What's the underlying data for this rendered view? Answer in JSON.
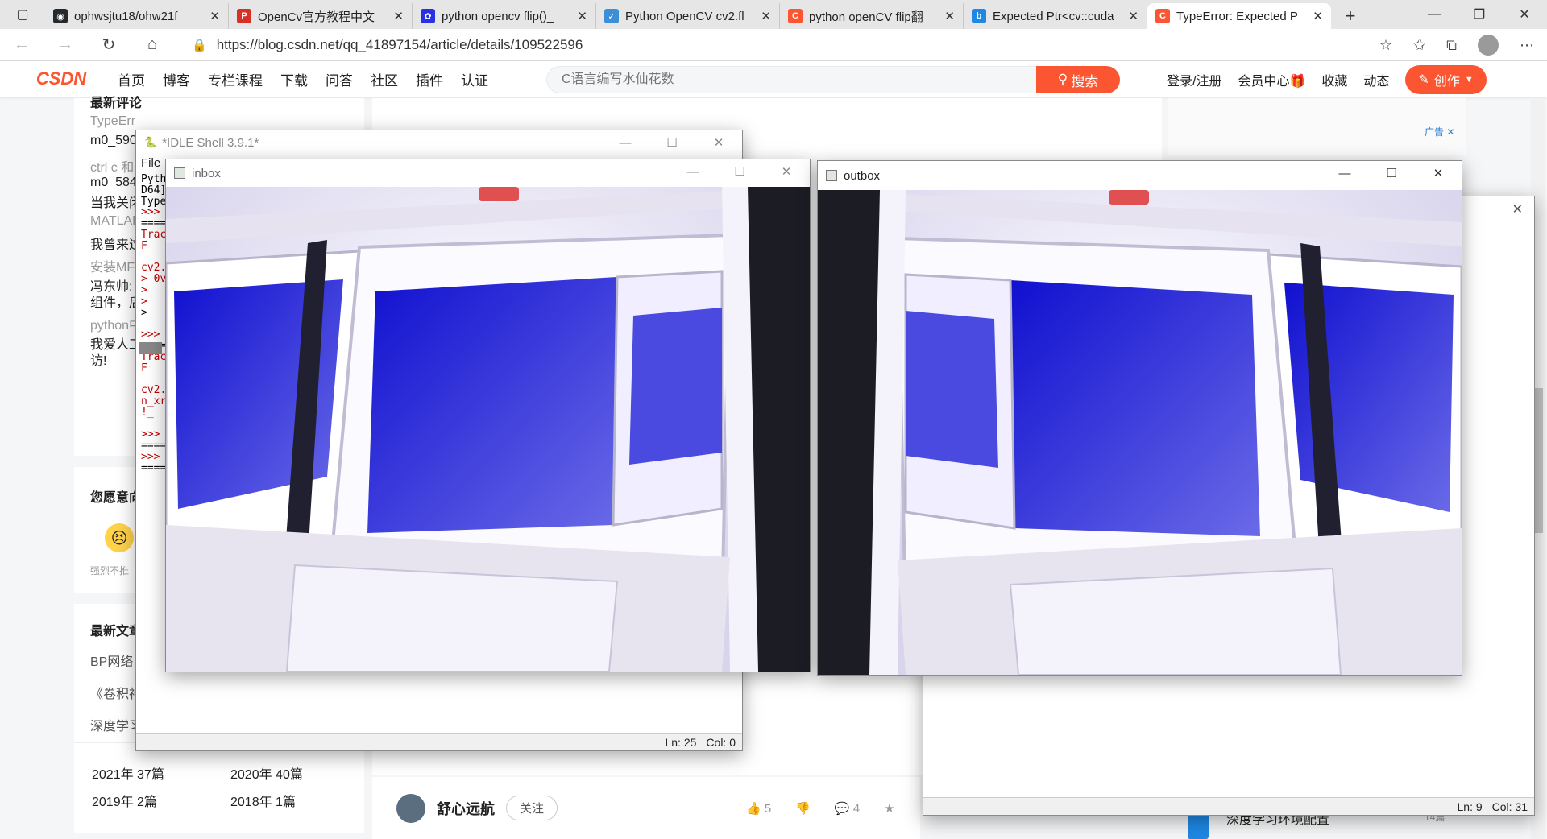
{
  "browser": {
    "tabs": [
      {
        "title": "ophwsjtu18/ohw21f",
        "favicon": "github-icon",
        "color": "#24292e",
        "glyph": "◉"
      },
      {
        "title": "OpenCv官方教程中文",
        "favicon": "pdf-icon",
        "color": "#d93025",
        "glyph": "P"
      },
      {
        "title": "python opencv flip()_",
        "favicon": "baidu-paw-icon",
        "color": "#2932e1",
        "glyph": "✿"
      },
      {
        "title": "Python OpenCV cv2.fl",
        "favicon": "check-icon",
        "color": "#3a8fd6",
        "glyph": "✓"
      },
      {
        "title": "python openCV flip翻",
        "favicon": "csdn-c-icon",
        "color": "#fc5531",
        "glyph": "C"
      },
      {
        "title": "Expected Ptr<cv::cuda",
        "favicon": "bing-icon",
        "color": "#1e88e5",
        "glyph": "b"
      },
      {
        "title": "TypeError: Expected P",
        "favicon": "csdn-c-icon",
        "color": "#fc5531",
        "glyph": "C"
      }
    ],
    "url": "https://blog.csdn.net/qq_41897154/article/details/109522596"
  },
  "csdn": {
    "nav": [
      "首页",
      "博客",
      "专栏课程",
      "下载",
      "问答",
      "社区",
      "插件",
      "认证"
    ],
    "search_placeholder": "C语言编写水仙花数",
    "search_button": "搜索",
    "header_right": {
      "login": "登录/注册",
      "vip": "会员中心",
      "collect": "收藏",
      "dynamic": "动态",
      "create": "创作"
    },
    "ad_label": "广告",
    "sidebar": {
      "recent_comments_title": "最新评论",
      "comment_lines": [
        "TypeErr",
        "m0_590",
        "ctrl c 和",
        "m0_584",
        "当我关闭",
        "MATLAB",
        "我曾来过",
        "安装MF",
        "冯东帅:",
        "组件，后",
        "python中",
        "我爱人工",
        "访!"
      ],
      "feedback_title": "您愿意向",
      "feedback_text": "强烈不推",
      "latest_title": "最新文章",
      "latest_items": [
        "BP网络",
        "《卷积神",
        "深度学习"
      ],
      "archive": [
        "2021年  37篇",
        "2020年  40篇",
        "2019年  2篇",
        "2018年  1篇"
      ]
    },
    "author": {
      "name": "舒心远航",
      "follow": "关注",
      "likes": "5",
      "comments": "4"
    },
    "right_snippet": "深度学习环境配置",
    "right_snippet_meta": "14篇"
  },
  "idle": {
    "title": "*IDLE Shell 3.9.1*",
    "menu_first": "File",
    "lines": [
      {
        "text": "Pyth",
        "color": "#000"
      },
      {
        "text": "D64]",
        "color": "#000"
      },
      {
        "text": "Type",
        "color": "#000"
      },
      {
        "text": ">>>",
        "color": "#c00000"
      },
      {
        "text": "====",
        "color": "#000"
      },
      {
        "text": "Trac",
        "color": "#c00000"
      },
      {
        "text": "  F",
        "color": "#c00000"
      },
      {
        "text": "",
        "color": "#000"
      },
      {
        "text": "cv2.",
        "color": "#c00000"
      },
      {
        "text": "> 0v",
        "color": "#c00000"
      },
      {
        "text": ">  ",
        "color": "#c00000"
      },
      {
        "text": ">  ",
        "color": "#c00000"
      },
      {
        "text": ">",
        "color": "#000"
      },
      {
        "text": "",
        "color": "#000"
      },
      {
        "text": ">>>",
        "color": "#c00000"
      },
      {
        "text": "====",
        "color": "#000"
      },
      {
        "text": "Trac",
        "color": "#c00000"
      },
      {
        "text": "  F",
        "color": "#c00000"
      },
      {
        "text": "",
        "color": "#000"
      },
      {
        "text": "cv2.",
        "color": "#c00000"
      },
      {
        "text": "n_xr",
        "color": "#c00000"
      },
      {
        "text": " !_",
        "color": "#c00000"
      },
      {
        "text": "",
        "color": "#000"
      },
      {
        "text": ">>>",
        "color": "#c00000"
      },
      {
        "text": "====",
        "color": "#000"
      },
      {
        "text": ">>>",
        "color": "#c00000"
      },
      {
        "text": "====",
        "color": "#000"
      }
    ],
    "status_ln": "Ln: 25",
    "status_col": "Col: 0"
  },
  "inbox": {
    "title": "inbox"
  },
  "outbox": {
    "title": "outbox"
  },
  "editor2": {
    "status_ln": "Ln: 9",
    "status_col": "Col: 31"
  }
}
